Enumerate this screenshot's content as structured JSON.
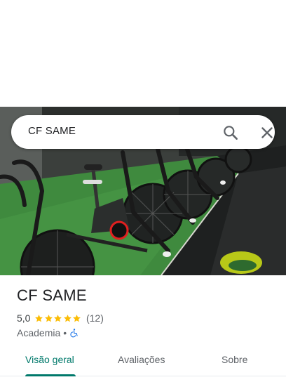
{
  "search": {
    "query": "CF SAME"
  },
  "place": {
    "name": "CF SAME",
    "rating": "5,0",
    "stars": 5,
    "review_count": "(12)",
    "category": "Academia",
    "separator": "•"
  },
  "tabs": [
    {
      "label": "Visão geral",
      "active": true
    },
    {
      "label": "Avaliações",
      "active": false
    },
    {
      "label": "Sobre",
      "active": false
    }
  ],
  "colors": {
    "accent": "#00796b",
    "star": "#fbbc04",
    "accessibility": "#1a73e8"
  },
  "icons": {
    "search": "search-icon",
    "close": "close-icon",
    "star": "star-icon",
    "accessibility": "wheelchair-icon"
  }
}
